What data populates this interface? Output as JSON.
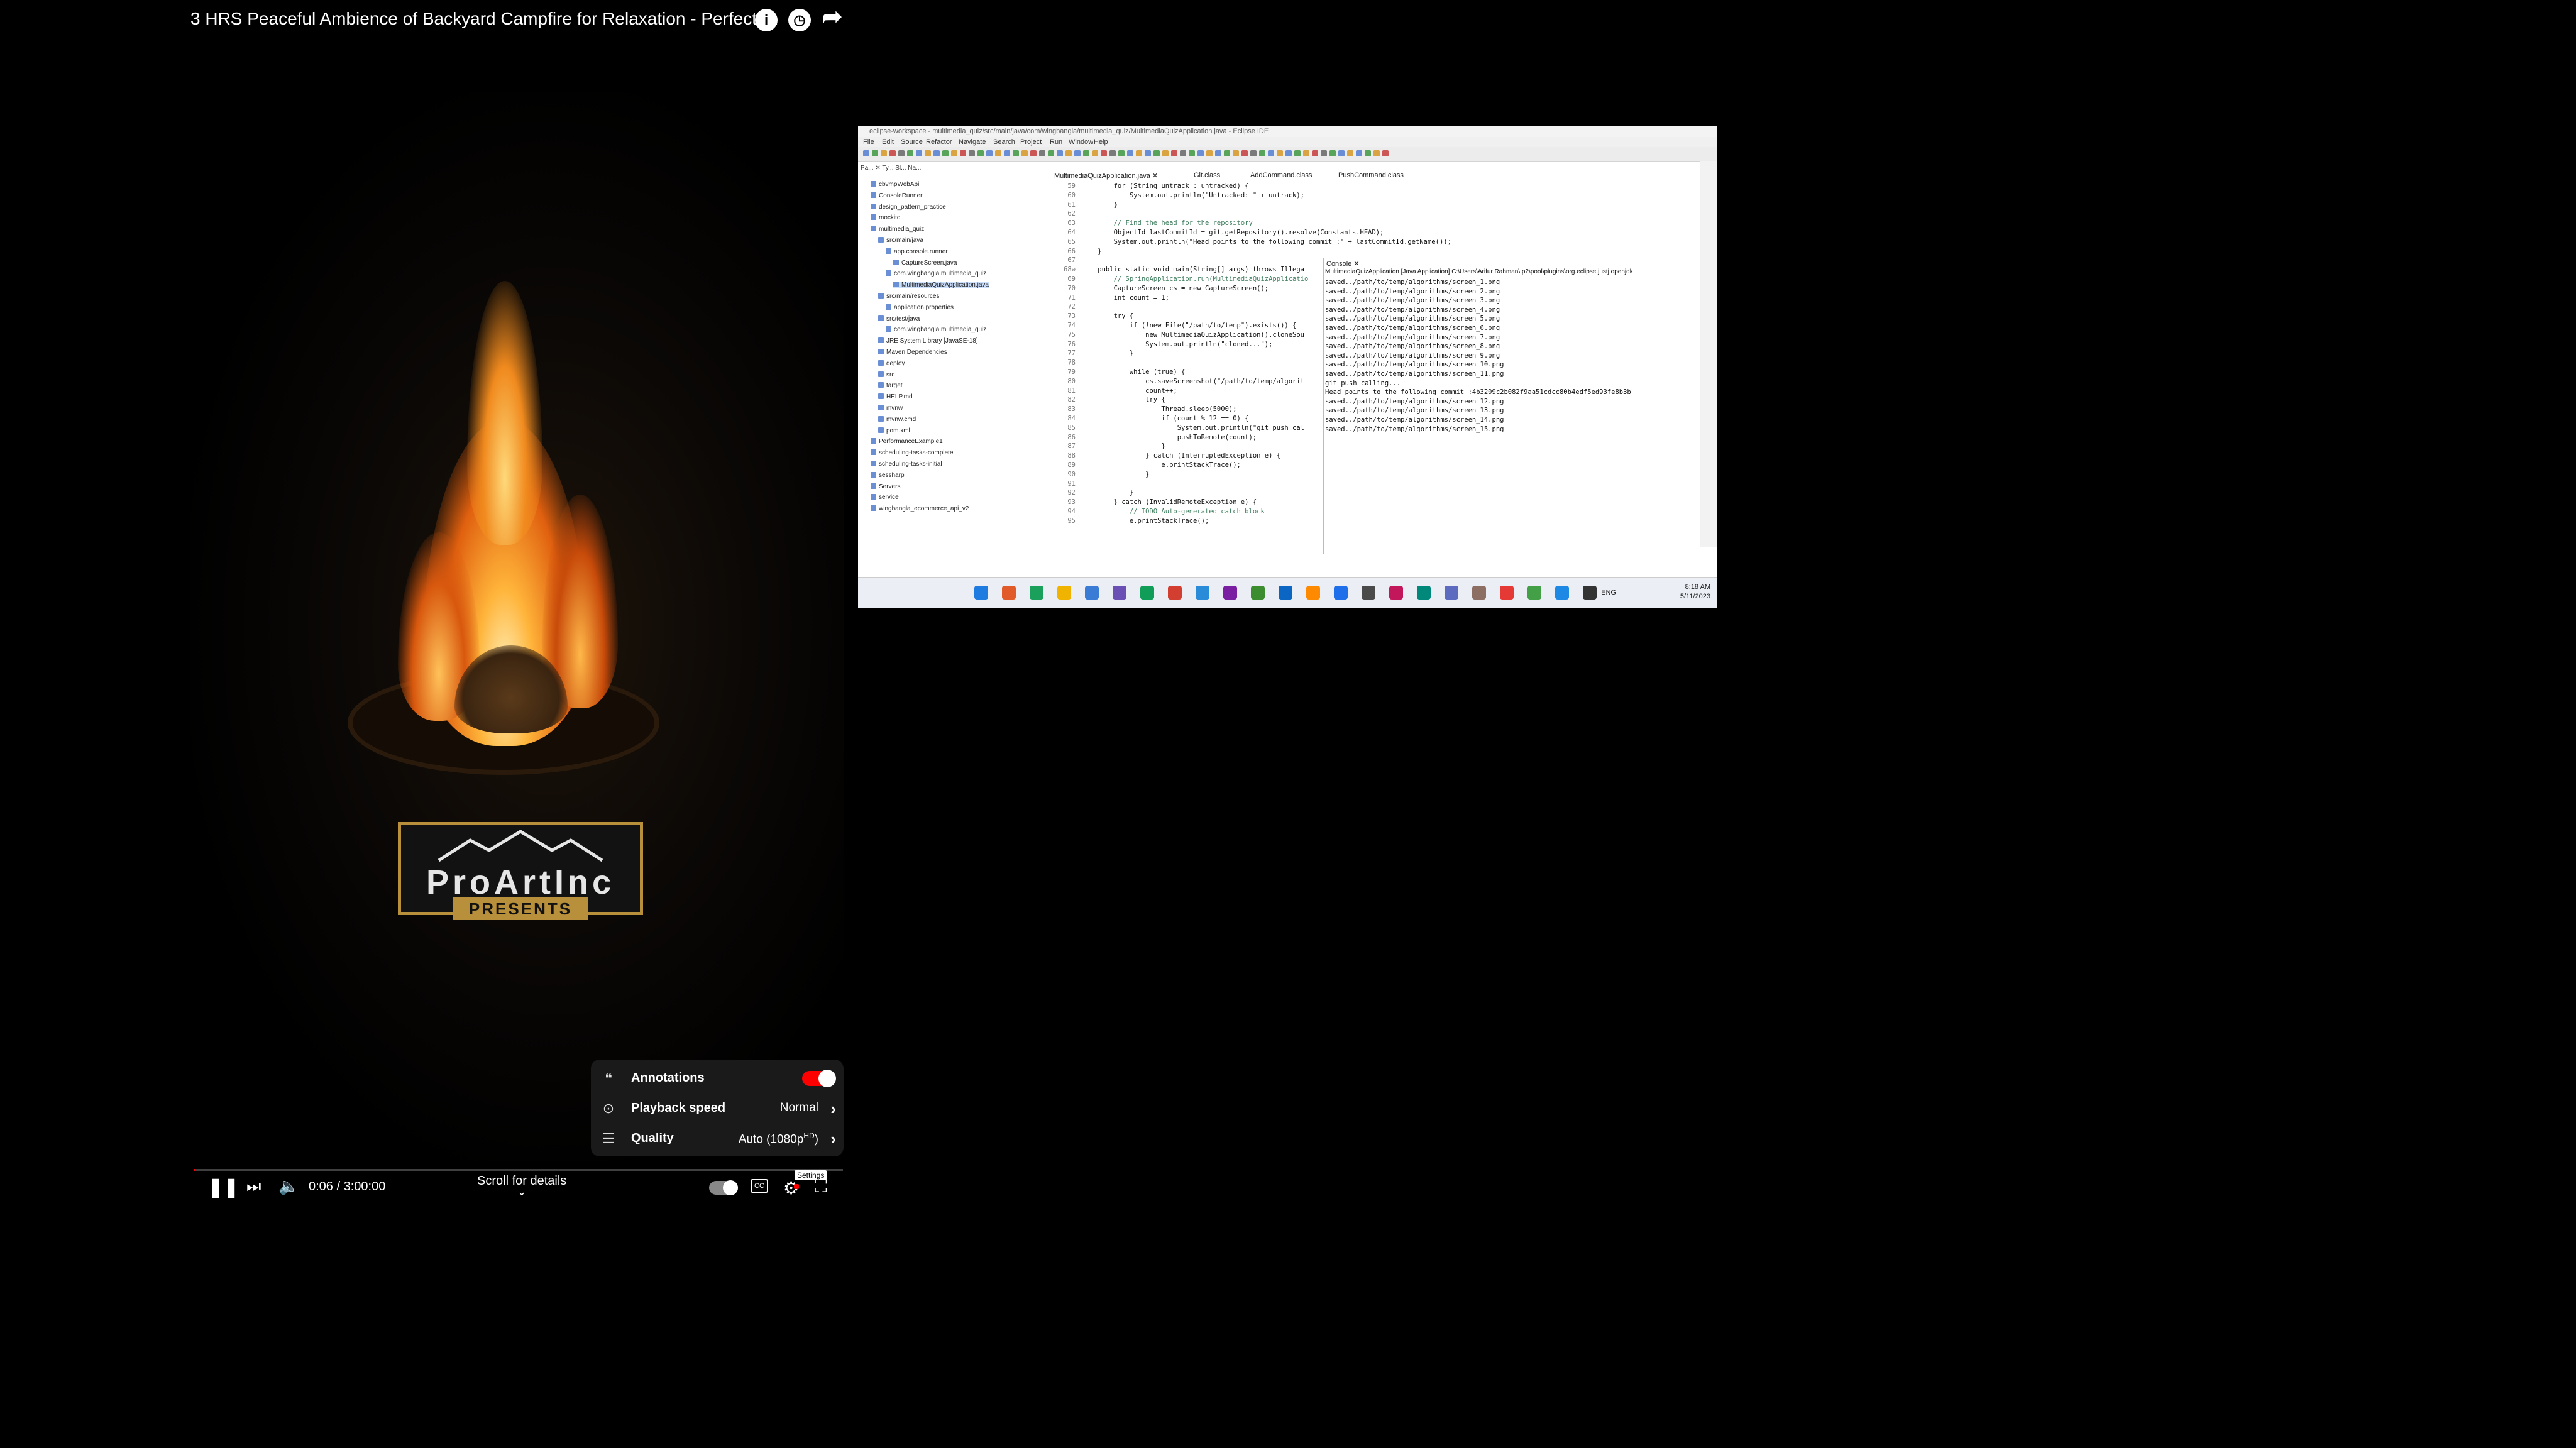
{
  "player": {
    "title": "3 HRS Peaceful Ambience of Backyard Campfire for Relaxation - Perfect …",
    "title_icons": [
      "info-icon",
      "clock-icon",
      "share-icon"
    ],
    "logo": {
      "brand": "ProArtInc",
      "subtitle": "PRESENTS"
    },
    "settings_menu": {
      "annotations": {
        "label": "Annotations",
        "enabled": true
      },
      "playback_speed": {
        "label": "Playback speed",
        "value": "Normal"
      },
      "quality": {
        "label": "Quality",
        "value": "Auto (1080p",
        "badge": "HD",
        "value_suffix": ")"
      }
    },
    "progress": {
      "fraction": 0.0006
    },
    "time": "0:06 / 3:00:00",
    "scroll_hint": "Scroll for details",
    "settings_tooltip": "Settings",
    "accent": "#ff0000"
  },
  "eclipse": {
    "window_title": "eclipse-workspace - multimedia_quiz/src/main/java/com/wingbangla/multimedia_quiz/MultimediaQuizApplication.java - Eclipse IDE",
    "menu": [
      "File",
      "Edit",
      "Source",
      "Refactor",
      "Navigate",
      "Search",
      "Project",
      "Run",
      "Window",
      "Help"
    ],
    "explorer_tabs": "Pa... ✕  Ty...  Sl...  Na...",
    "tree": [
      "cbvmpWebApi",
      "ConsoleRunner",
      "design_pattern_practice",
      "mockito",
      "multimedia_quiz",
      "src/main/java",
      "app.console.runner",
      "CaptureScreen.java",
      "com.wingbangla.multimedia_quiz",
      "MultimediaQuizApplication.java",
      "src/main/resources",
      "application.properties",
      "src/test/java",
      "com.wingbangla.multimedia_quiz",
      "JRE System Library [JavaSE-18]",
      "Maven Dependencies",
      "deploy",
      "src",
      "target",
      "HELP.md",
      "mvnw",
      "mvnw.cmd",
      "pom.xml",
      "PerformanceExample1",
      "scheduling-tasks-complete",
      "scheduling-tasks-initial",
      "sessharp",
      "Servers",
      "service",
      "wingbangla_ecommerce_api_v2"
    ],
    "editor_tabs": [
      "MultimediaQuizApplication.java ✕",
      "Git.class",
      "AddCommand.class",
      "PushCommand.class"
    ],
    "code": [
      {
        "n": "59",
        "t": "        for (String untrack : untracked) {"
      },
      {
        "n": "60",
        "t": "            System.out.println(\"Untracked: \" + untrack);"
      },
      {
        "n": "61",
        "t": "        }"
      },
      {
        "n": "62",
        "t": ""
      },
      {
        "n": "63",
        "t": "        // Find the head for the repository"
      },
      {
        "n": "64",
        "t": "        ObjectId lastCommitId = git.getRepository().resolve(Constants.HEAD);"
      },
      {
        "n": "65",
        "t": "        System.out.println(\"Head points to the following commit :\" + lastCommitId.getName());"
      },
      {
        "n": "66",
        "t": "    }"
      },
      {
        "n": "67",
        "t": ""
      },
      {
        "n": "68⊖",
        "t": "    public static void main(String[] args) throws Illega"
      },
      {
        "n": "69",
        "t": "        // SpringApplication.run(MultimediaQuizApplicatio"
      },
      {
        "n": "70",
        "t": "        CaptureScreen cs = new CaptureScreen();"
      },
      {
        "n": "71",
        "t": "        int count = 1;"
      },
      {
        "n": "72",
        "t": ""
      },
      {
        "n": "73",
        "t": "        try {"
      },
      {
        "n": "74",
        "t": "            if (!new File(\"/path/to/temp\").exists()) {"
      },
      {
        "n": "75",
        "t": "                new MultimediaQuizApplication().cloneSou"
      },
      {
        "n": "76",
        "t": "                System.out.println(\"cloned...\");"
      },
      {
        "n": "77",
        "t": "            }"
      },
      {
        "n": "78",
        "t": ""
      },
      {
        "n": "79",
        "t": "            while (true) {"
      },
      {
        "n": "80",
        "t": "                cs.saveScreenshot(\"/path/to/temp/algorit"
      },
      {
        "n": "81",
        "t": "                count++;"
      },
      {
        "n": "82",
        "t": "                try {"
      },
      {
        "n": "83",
        "t": "                    Thread.sleep(5000);"
      },
      {
        "n": "84",
        "t": "                    if (count % 12 == 0) {"
      },
      {
        "n": "85",
        "t": "                        System.out.println(\"git push cal"
      },
      {
        "n": "86",
        "t": "                        pushToRemote(count);"
      },
      {
        "n": "87",
        "t": "                    }"
      },
      {
        "n": "88",
        "t": "                } catch (InterruptedException e) {"
      },
      {
        "n": "89",
        "t": "                    e.printStackTrace();"
      },
      {
        "n": "90",
        "t": "                }"
      },
      {
        "n": "91",
        "t": ""
      },
      {
        "n": "92",
        "t": "            }"
      },
      {
        "n": "93",
        "t": "        } catch (InvalidRemoteException e) {"
      },
      {
        "n": "94",
        "t": "            // TODO Auto-generated catch block"
      },
      {
        "n": "95",
        "t": "            e.printStackTrace();"
      }
    ],
    "console": {
      "tab": "Console ✕",
      "header": "MultimediaQuizApplication [Java Application] C:\\Users\\Arifur Rahman\\.p2\\pool\\plugins\\org.eclipse.justj.openjdk",
      "lines": [
        "saved../path/to/temp/algorithms/screen_1.png",
        "saved../path/to/temp/algorithms/screen_2.png",
        "saved../path/to/temp/algorithms/screen_3.png",
        "saved../path/to/temp/algorithms/screen_4.png",
        "saved../path/to/temp/algorithms/screen_5.png",
        "saved../path/to/temp/algorithms/screen_6.png",
        "saved../path/to/temp/algorithms/screen_7.png",
        "saved../path/to/temp/algorithms/screen_8.png",
        "saved../path/to/temp/algorithms/screen_9.png",
        "saved../path/to/temp/algorithms/screen_10.png",
        "saved../path/to/temp/algorithms/screen_11.png",
        "git push calling...",
        "Head points to the following commit :4b3209c2b082f9aa51cdcc80b4edf5ed93fe8b3b",
        "saved../path/to/temp/algorithms/screen_12.png",
        "saved../path/to/temp/algorithms/screen_13.png",
        "saved../path/to/temp/algorithms/screen_14.png",
        "saved../path/to/temp/algorithms/screen_15.png"
      ]
    },
    "taskbar": {
      "lang": "ENG",
      "time": "8:18 AM",
      "date": "5/11/2023"
    }
  }
}
